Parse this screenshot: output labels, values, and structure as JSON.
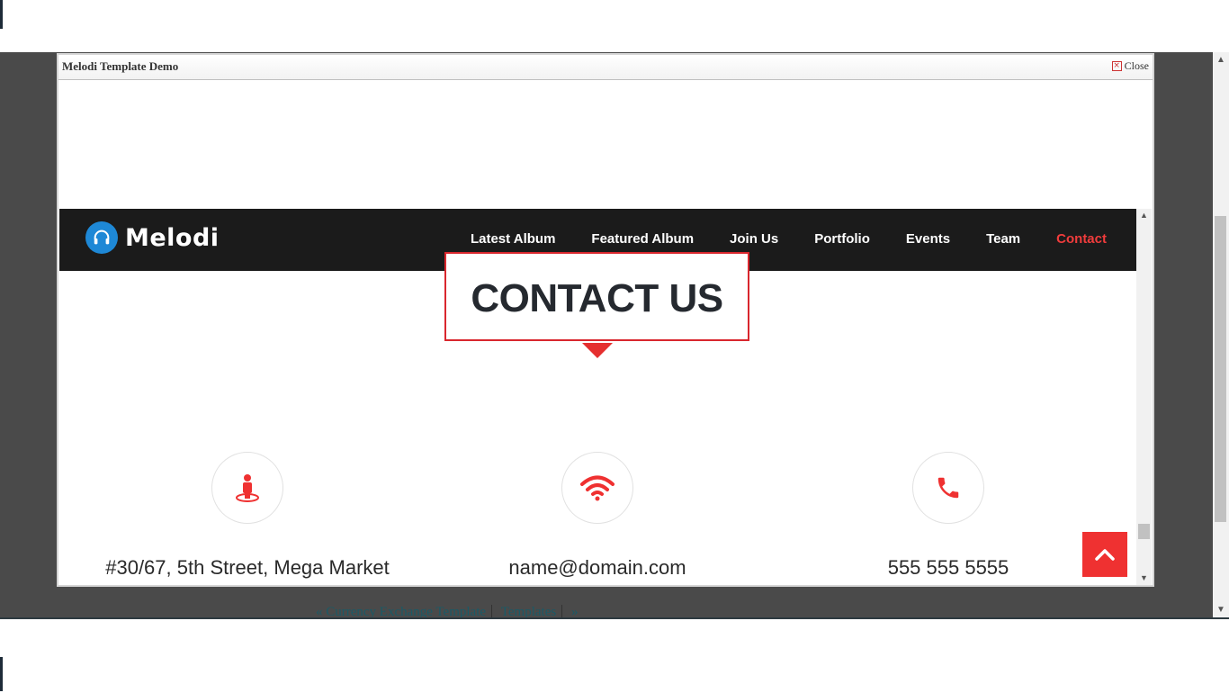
{
  "modal": {
    "title": "Melodi Template Demo",
    "close_label": "Close"
  },
  "site": {
    "brand": "Melodi",
    "nav": [
      {
        "label": "Latest Album"
      },
      {
        "label": "Featured Album"
      },
      {
        "label": "Join Us"
      },
      {
        "label": "Portfolio"
      },
      {
        "label": "Events"
      },
      {
        "label": "Team"
      },
      {
        "label": "Contact",
        "active": true
      }
    ],
    "heading": "CONTACT US",
    "contacts": [
      {
        "icon": "person-location-icon",
        "text": "#30/67, 5th Street, Mega Market"
      },
      {
        "icon": "wifi-icon",
        "text": "name@domain.com"
      },
      {
        "icon": "phone-icon",
        "text": "555 555 5555"
      }
    ],
    "accent_color": "#ef3131",
    "navbar_color": "#1b1b1b",
    "logo_color": "#1e88d6"
  },
  "background": {
    "links": [
      "« Currency Exchange Template",
      "Templates",
      "»"
    ]
  }
}
